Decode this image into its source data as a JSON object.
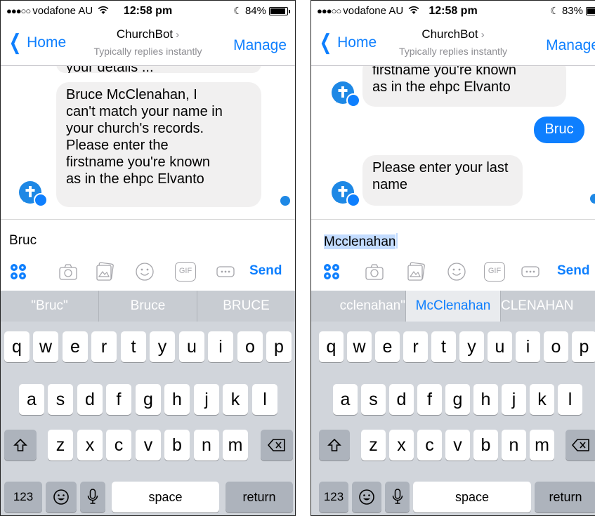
{
  "screens": [
    {
      "status": {
        "signal": "●●●○○",
        "carrier": "vodafone AU",
        "time": "12:58 pm",
        "battery": "84%",
        "battery_level": 0.84
      },
      "nav": {
        "back_label": "Home",
        "title": "ChurchBot",
        "subtitle": "Typically replies instantly",
        "manage_label": "Manage"
      },
      "messages": [
        {
          "lines": [
            "your details ..."
          ]
        },
        {
          "lines": [
            "Bruce McClenahan, I",
            "can't match your name in",
            "your church's records.",
            "Please enter the",
            "firstname you're known",
            "as in the ehpc Elvanto"
          ]
        }
      ],
      "input_value": "Bruc",
      "send_label": "Send",
      "predictions": [
        "\"Bruc\"",
        "Bruce",
        "BRUCE"
      ],
      "highlighted_prediction": -1
    },
    {
      "status": {
        "signal": "●●●○○",
        "carrier": "vodafone AU",
        "time": "12:58 pm",
        "battery": "83%",
        "battery_level": 0.83
      },
      "nav": {
        "back_label": "Home",
        "title": "ChurchBot",
        "subtitle": "Typically replies instantly",
        "manage_label": "Manage"
      },
      "messages": [
        {
          "lines": [
            "firstname you're known",
            "as in the ehpc Elvanto"
          ]
        },
        {
          "lines": [
            "Bruc"
          ]
        },
        {
          "lines": [
            "Please enter your last",
            "name"
          ]
        }
      ],
      "input_value": "Mcclenahan",
      "send_label": "Send",
      "predictions": [
        "cclenahan\"",
        "McClenahan",
        "CLENAHAN"
      ],
      "highlighted_prediction": 1
    }
  ],
  "keyboard": {
    "row1": [
      "q",
      "w",
      "e",
      "r",
      "t",
      "y",
      "u",
      "i",
      "o",
      "p"
    ],
    "row2": [
      "a",
      "s",
      "d",
      "f",
      "g",
      "h",
      "j",
      "k",
      "l"
    ],
    "row3": [
      "z",
      "x",
      "c",
      "v",
      "b",
      "n",
      "m"
    ],
    "numbers_label": "123",
    "space_label": "space",
    "return_label": "return"
  },
  "icons": {
    "toolbar": [
      "apps-icon",
      "camera-icon",
      "gallery-icon",
      "sticker-icon",
      "gif-icon",
      "more-icon"
    ],
    "gif_text": "GIF"
  },
  "colors": {
    "accent": "#0e7ffe",
    "bot_bubble": "#f1f0f0",
    "keyboard_bg": "#d1d5db"
  }
}
